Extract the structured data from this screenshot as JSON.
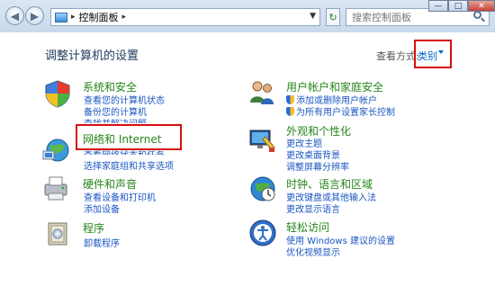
{
  "window": {
    "breadcrumb": "控制面板",
    "search_placeholder": "搜索控制面板",
    "minimize": "—",
    "maximize": "□",
    "close": "✕"
  },
  "main": {
    "heading": "调整计算机的设置",
    "view_by_label": "查看方式:",
    "view_by_value": "类别"
  },
  "categories": {
    "system": {
      "title": "系统和安全",
      "links": [
        "查看您的计算机状态",
        "备份您的计算机",
        "查找并解决问题"
      ]
    },
    "network": {
      "title": "网络和 Internet",
      "links": [
        "查看网络状态和任务",
        "选择家庭组和共享选项"
      ]
    },
    "hardware": {
      "title": "硬件和声音",
      "links": [
        "查看设备和打印机",
        "添加设备"
      ]
    },
    "programs": {
      "title": "程序",
      "links": [
        "卸载程序"
      ]
    },
    "users": {
      "title": "用户帐户和家庭安全",
      "links": [
        "添加或删除用户帐户",
        "为所有用户设置家长控制"
      ]
    },
    "appearance": {
      "title": "外观和个性化",
      "links": [
        "更改主题",
        "更改桌面背景",
        "调整屏幕分辨率"
      ]
    },
    "clock": {
      "title": "时钟、语言和区域",
      "links": [
        "更改键盘或其他输入法",
        "更改显示语言"
      ]
    },
    "ease": {
      "title": "轻松访问",
      "links": [
        "使用 Windows 建议的设置",
        "优化视频显示"
      ]
    }
  },
  "colors": {
    "category_title": "#26851a",
    "link": "#1a56c2",
    "highlight_box": "#d60f0f"
  }
}
